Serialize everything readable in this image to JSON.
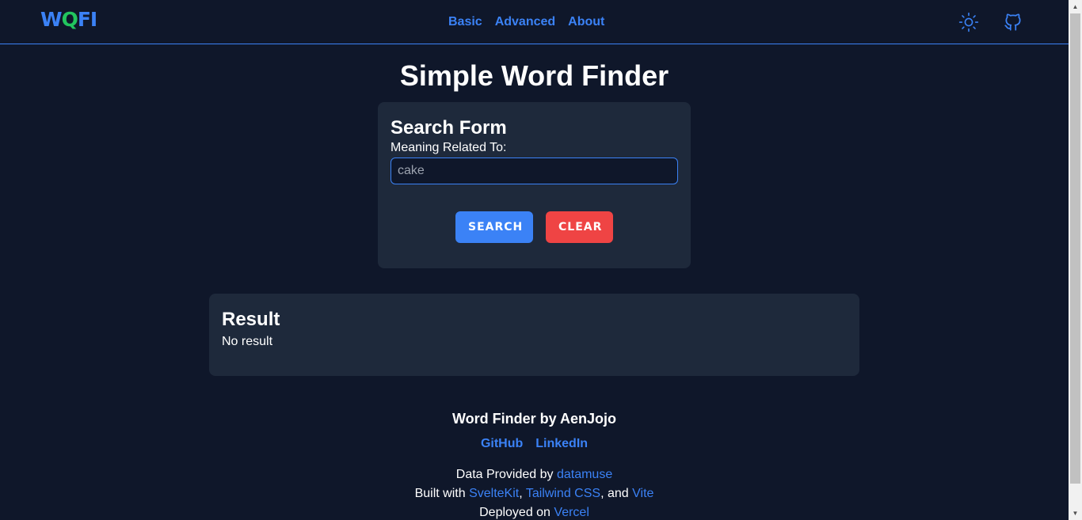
{
  "header": {
    "logo": {
      "part1": "W",
      "part2": "Q",
      "part3": "FI"
    },
    "nav": [
      {
        "label": "Basic"
      },
      {
        "label": "Advanced"
      },
      {
        "label": "About"
      }
    ],
    "theme_toggle_icon": "sun-icon",
    "github_icon": "github-icon"
  },
  "main": {
    "title": "Simple Word Finder",
    "search_form": {
      "heading": "Search Form",
      "field_label": "Meaning Related To:",
      "field_placeholder": "cake",
      "field_value": "",
      "search_button": "SEARCH",
      "clear_button": "CLEAR"
    },
    "result": {
      "heading": "Result",
      "text": "No result"
    }
  },
  "footer": {
    "title": "Word Finder by AenJojo",
    "links": [
      {
        "label": "GitHub"
      },
      {
        "label": "LinkedIn"
      }
    ],
    "data_line": {
      "prefix": "Data Provided by",
      "link": "datamuse"
    },
    "built_line": {
      "prefix": "Built with",
      "link1": "SvelteKit",
      "sep1": ",",
      "link2": "Tailwind CSS",
      "sep2": ", and",
      "link3": "Vite"
    },
    "deploy_line": {
      "prefix": "Deployed on",
      "link": "Vercel"
    }
  },
  "colors": {
    "background": "#0f172a",
    "card": "#1e293b",
    "accent_blue": "#3b82f6",
    "accent_green": "#22c55e",
    "clear_red": "#ef4444"
  }
}
